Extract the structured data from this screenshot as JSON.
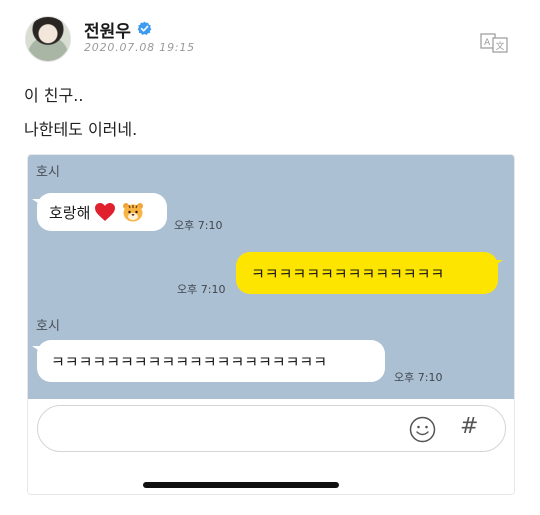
{
  "post": {
    "author": "전원우",
    "timestamp": "2020.07.08 19:15",
    "text_lines": [
      "이 친구..",
      "나한테도 이러네."
    ],
    "icons": {
      "verified": "verified-badge-icon",
      "translate": "translate-icon"
    },
    "colors": {
      "verified": "#3d9bf0"
    }
  },
  "chat": {
    "messages": [
      {
        "sender": "호시",
        "text": "호랑해",
        "emojis": [
          "heart-emoji",
          "tiger-emoji"
        ],
        "time": "오후 7:10",
        "direction": "incoming"
      },
      {
        "text": "ㅋㅋㅋㅋㅋㅋㅋㅋㅋㅋㅋㅋㅋㅋ",
        "time": "오후 7:10",
        "direction": "outgoing"
      },
      {
        "sender": "호시",
        "text": "ㅋㅋㅋㅋㅋㅋㅋㅋㅋㅋㅋㅋㅋㅋㅋㅋㅋㅋㅋㅋ",
        "time": "오후 7:10",
        "direction": "incoming"
      }
    ],
    "input": {
      "placeholder": "",
      "emoji_button_icon": "smiley-icon",
      "hash_button_label": "#"
    },
    "colors": {
      "background": "#acc0d4",
      "outgoing_bubble": "#fee500",
      "incoming_bubble": "#ffffff"
    }
  }
}
